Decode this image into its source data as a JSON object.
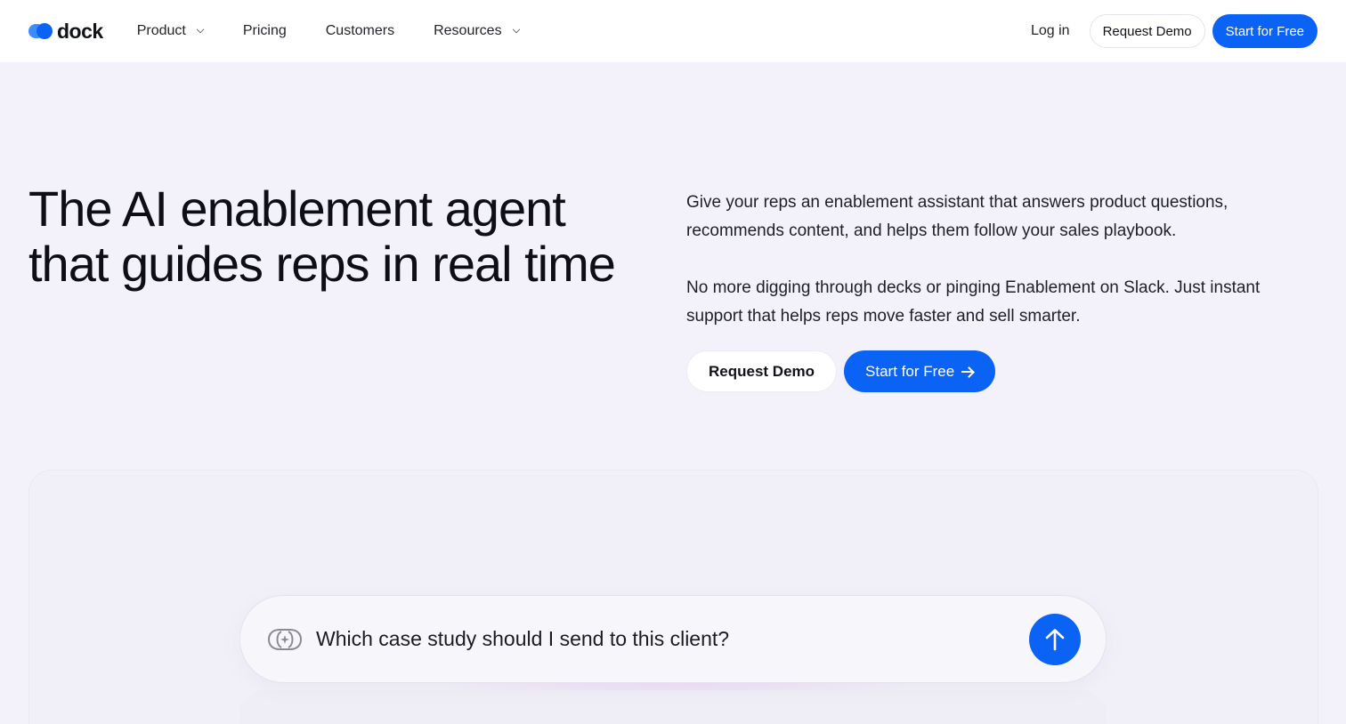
{
  "nav": {
    "logo_text": "dock",
    "links": [
      {
        "label": "Product",
        "has_dropdown": true
      },
      {
        "label": "Pricing",
        "has_dropdown": false
      },
      {
        "label": "Customers",
        "has_dropdown": false
      },
      {
        "label": "Resources",
        "has_dropdown": true
      }
    ],
    "login": "Log in",
    "request_demo": "Request Demo",
    "start_free": "Start for Free"
  },
  "hero": {
    "title": "The AI enablement agent that guides reps in real time",
    "paragraph_1": "Give your reps an enablement assistant that answers product questions, recommends content, and helps them follow your sales playbook.",
    "paragraph_2": "No more digging through decks or pinging Enablement on Slack.  Just instant support that helps reps move faster and sell smarter.",
    "cta_demo": "Request Demo",
    "cta_start": "Start for Free"
  },
  "chat": {
    "prompt": "Which case study should I send to this client?"
  },
  "colors": {
    "accent": "#0b63f6",
    "background": "#f3f2fb",
    "nav_bg": "#ffffff"
  }
}
